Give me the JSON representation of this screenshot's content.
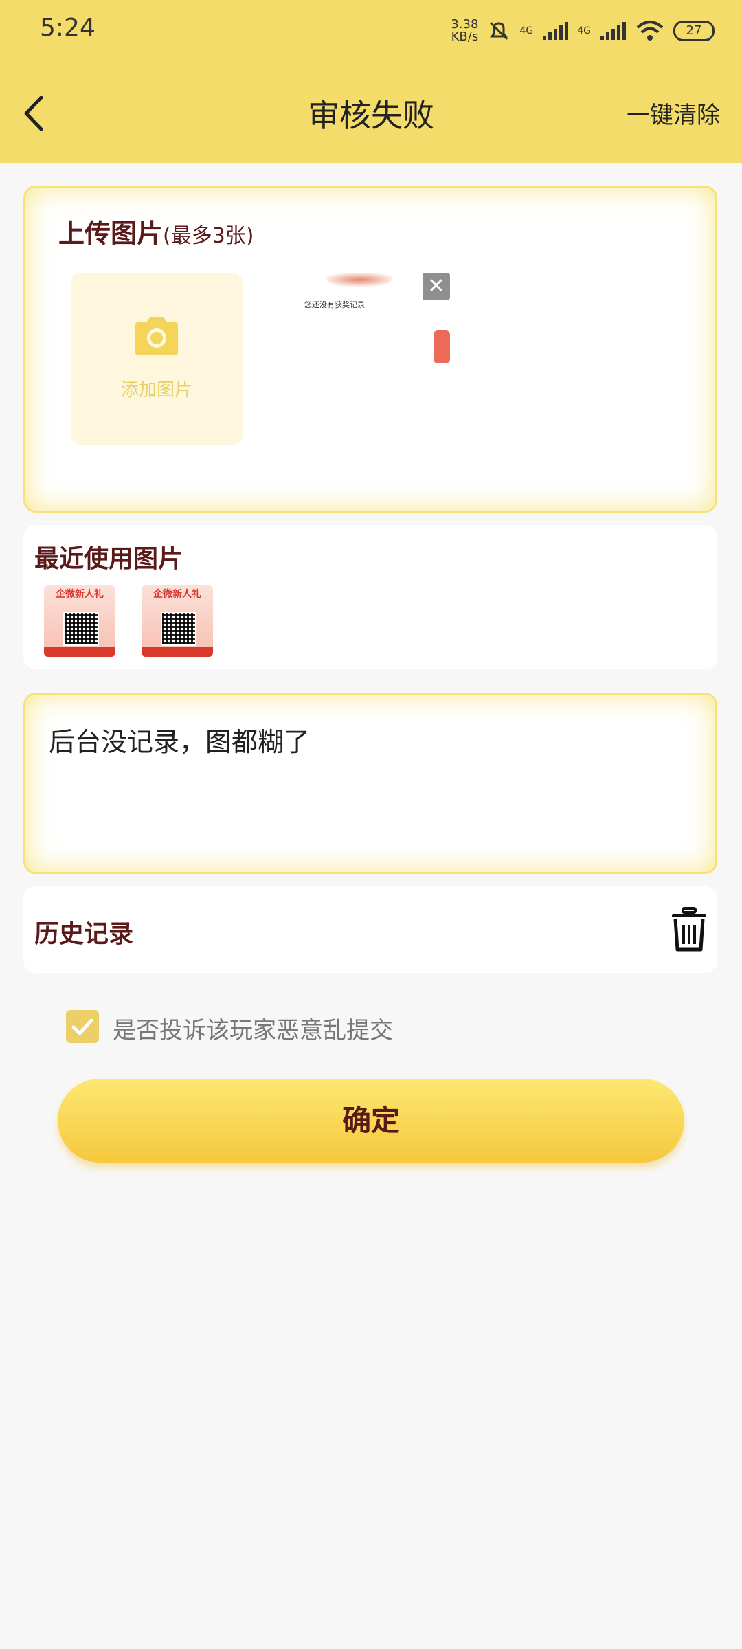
{
  "status_bar": {
    "time": "5:24",
    "speed_value": "3.38",
    "speed_unit": "KB/s",
    "network_1": "4G",
    "network_2": "4G",
    "battery": "27"
  },
  "nav": {
    "title": "审核失败",
    "clear_all": "一键清除"
  },
  "upload": {
    "title": "上传图片",
    "limit": "(最多3张)",
    "add_label": "添加图片",
    "thumbnail_text": "您还没有获奖记录"
  },
  "recent": {
    "title": "最近使用图片",
    "items": [
      {
        "heading": "企微新人礼"
      },
      {
        "heading": "企微新人礼"
      }
    ]
  },
  "comment": {
    "value": "后台没记录，图都糊了"
  },
  "history": {
    "title": "历史记录"
  },
  "complaint": {
    "label": "是否投诉该玩家恶意乱提交",
    "checked": true
  },
  "confirm_label": "确定",
  "colors": {
    "header_bg": "#f4dc6a",
    "accent_yellow": "#f5c83d",
    "title_brown": "#5a1a1a"
  }
}
